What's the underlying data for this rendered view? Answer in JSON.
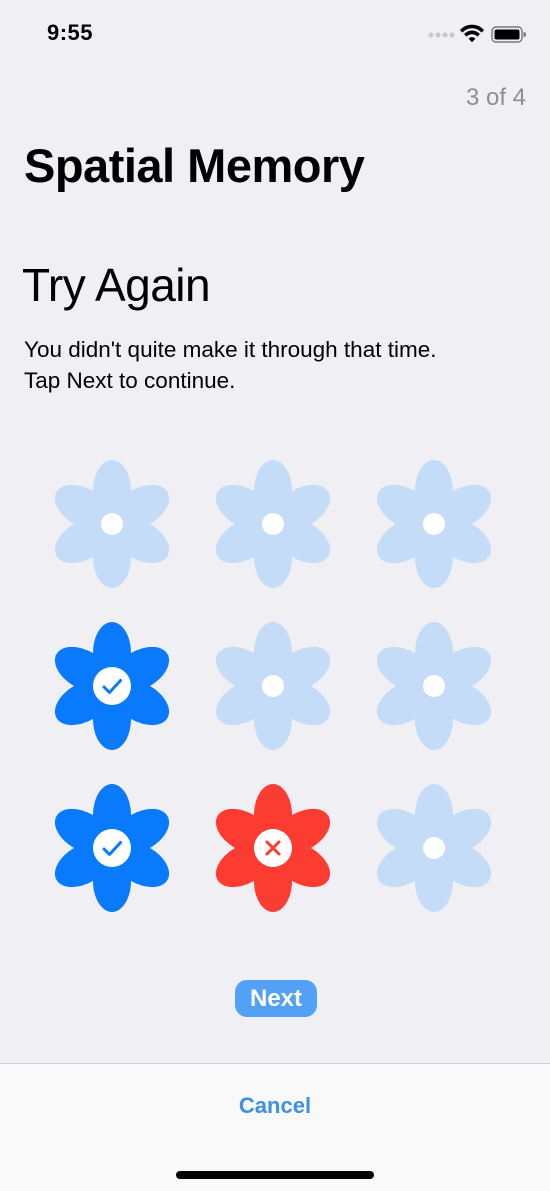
{
  "status_bar": {
    "time": "9:55",
    "icons": [
      "cellular-dots-icon",
      "wifi-icon",
      "battery-icon"
    ]
  },
  "header": {
    "step": "3 of 4",
    "title": "Spatial Memory"
  },
  "result": {
    "heading": "Try Again",
    "message_lines": [
      "You didn't quite make it through that time.",
      "Tap Next to continue."
    ]
  },
  "grid": {
    "rows": 3,
    "cols": 3,
    "cells": [
      {
        "state": "inactive"
      },
      {
        "state": "inactive"
      },
      {
        "state": "inactive"
      },
      {
        "state": "correct"
      },
      {
        "state": "inactive"
      },
      {
        "state": "inactive"
      },
      {
        "state": "correct"
      },
      {
        "state": "wrong"
      },
      {
        "state": "inactive"
      }
    ]
  },
  "buttons": {
    "next_label": "Next",
    "cancel_label": "Cancel"
  },
  "colors": {
    "inactive": "#c4dcf7",
    "correct": "#0a7afd",
    "wrong": "#fc3c30",
    "next_button": "#52a1f7",
    "cancel_text": "#3d8fe7",
    "check": "#0a7afd",
    "cross": "#fc3c30"
  }
}
